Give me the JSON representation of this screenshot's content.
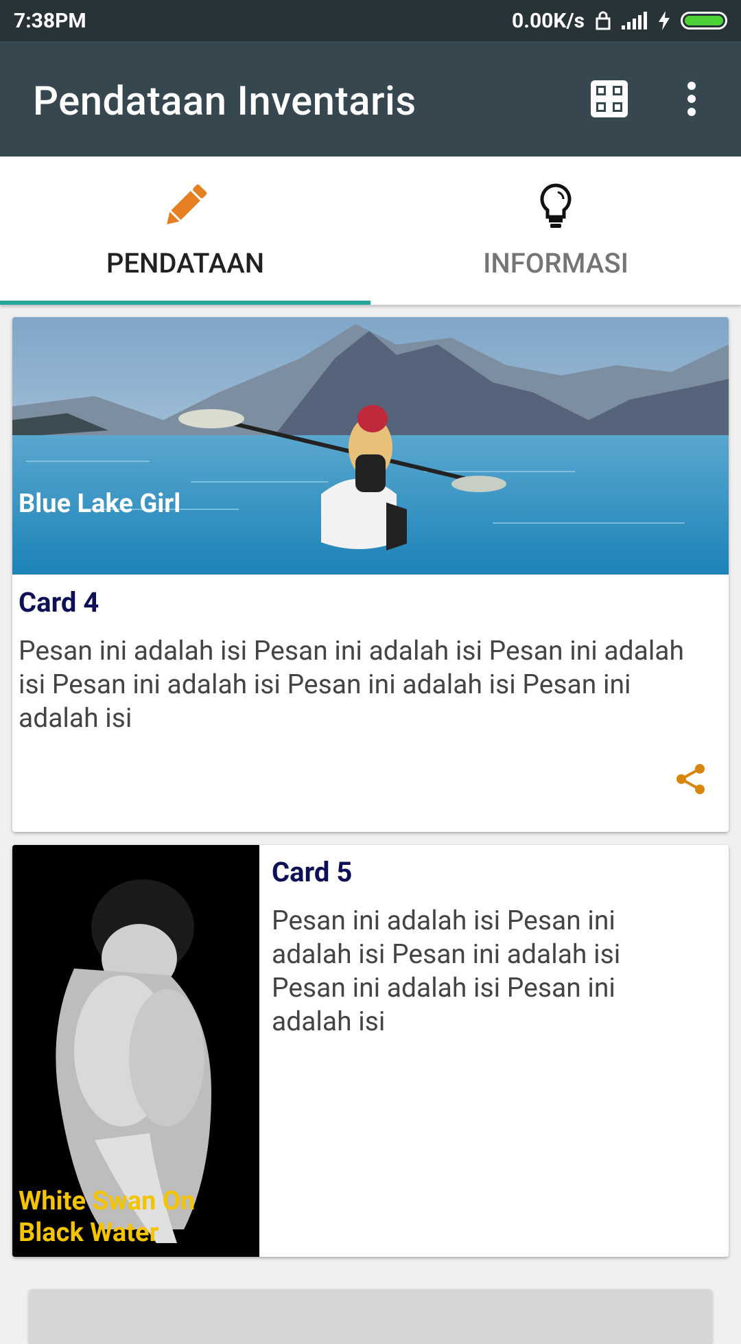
{
  "status": {
    "time": "7:38PM",
    "network_speed": "0.00K/s"
  },
  "appbar": {
    "title": "Pendataan Inventaris",
    "icons": [
      "scan-icon",
      "overflow-menu-icon"
    ]
  },
  "tabs": [
    {
      "label": "PENDATAAN",
      "icon": "pencil-icon",
      "selected": true
    },
    {
      "label": "INFORMASI",
      "icon": "lightbulb-icon",
      "selected": false
    }
  ],
  "cards": [
    {
      "image_caption": "Blue Lake Girl",
      "title": "Card 4",
      "body": "Pesan ini adalah isi Pesan ini adalah isi Pesan ini adalah isi Pesan ini adalah isi Pesan ini adalah isi Pesan ini adalah isi",
      "action_icon": "share-icon"
    },
    {
      "image_caption": "White Swan On Black Water",
      "title": "Card 5",
      "body": "Pesan ini adalah isi Pesan ini adalah isi Pesan ini adalah isi Pesan ini adalah isi Pesan ini adalah isi"
    }
  ],
  "bottom_button": {
    "label": ""
  },
  "colors": {
    "appbar": "#37474f",
    "statusbar": "#283338",
    "tab_indicator": "#26a69a",
    "pencil_icon": "#e67e22",
    "share_icon": "#d9860b",
    "card_title": "#0d1057",
    "caption_yellow": "#f5c400"
  }
}
